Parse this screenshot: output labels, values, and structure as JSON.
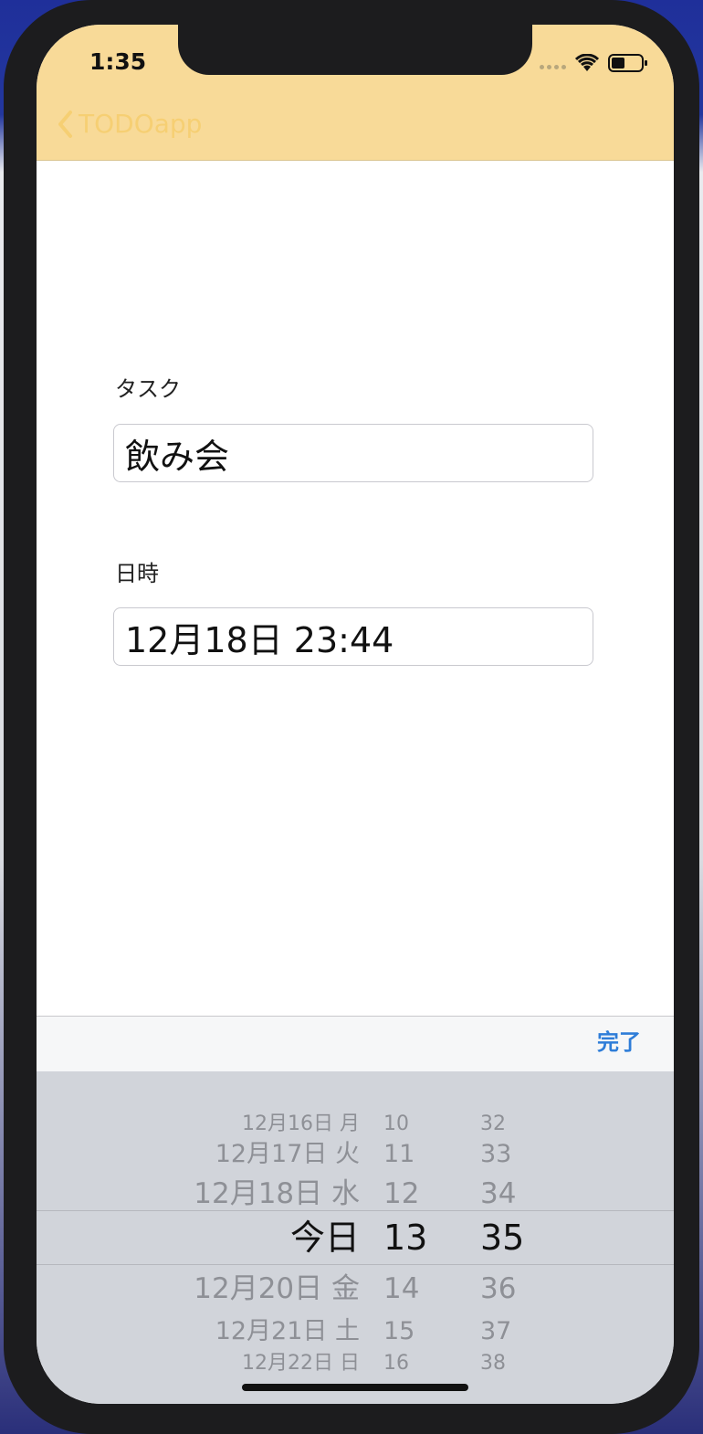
{
  "status": {
    "time": "1:35"
  },
  "nav": {
    "back_label": "TODOapp"
  },
  "form": {
    "task_label": "タスク",
    "task_value": "飲み会",
    "datetime_label": "日時",
    "datetime_value": "12月18日 23:44"
  },
  "toolbar": {
    "done_label": "完了"
  },
  "picker": {
    "rows": [
      {
        "date": "12月16日 月",
        "hour": "10",
        "minute": "32"
      },
      {
        "date": "12月17日 火",
        "hour": "11",
        "minute": "33"
      },
      {
        "date": "12月18日 水",
        "hour": "12",
        "minute": "34"
      },
      {
        "date": "今日",
        "hour": "13",
        "minute": "35"
      },
      {
        "date": "12月20日 金",
        "hour": "14",
        "minute": "36"
      },
      {
        "date": "12月21日 土",
        "hour": "15",
        "minute": "37"
      },
      {
        "date": "12月22日 日",
        "hour": "16",
        "minute": "38"
      }
    ]
  },
  "colors": {
    "nav_bar": "#f8da98",
    "accent": "#2e7dd8"
  }
}
